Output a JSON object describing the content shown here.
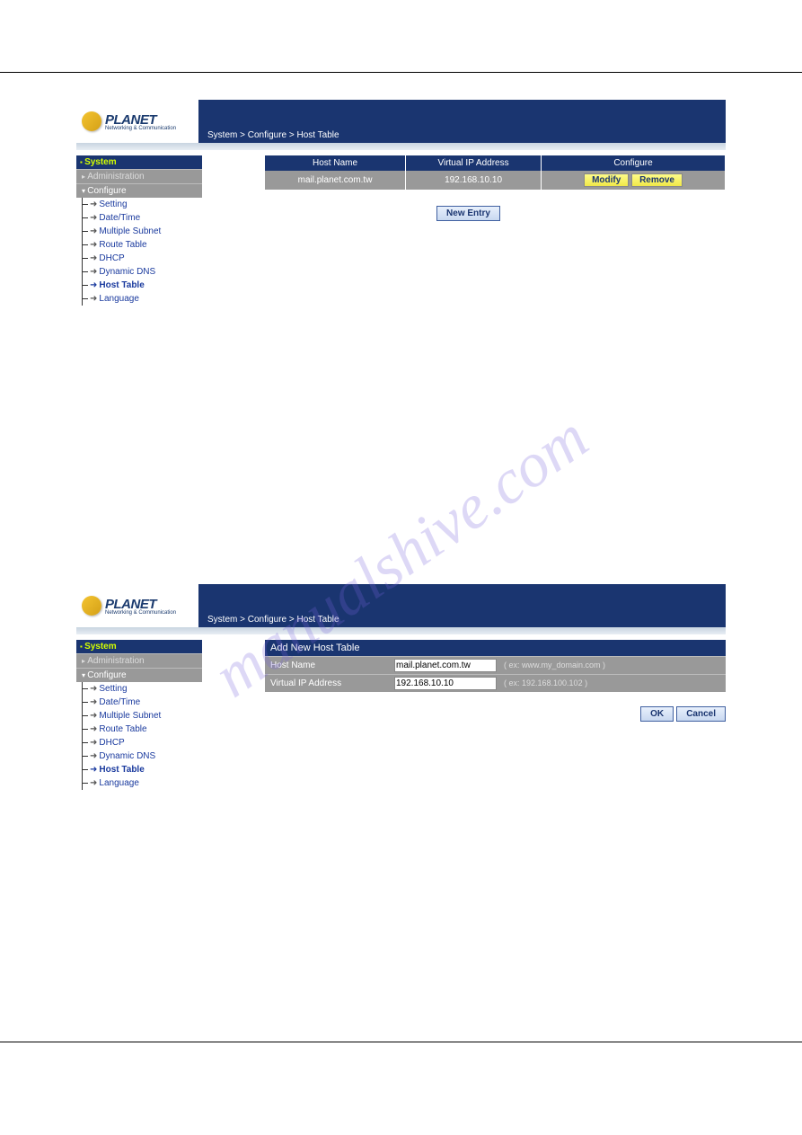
{
  "watermark": "manualshive.com",
  "brand": {
    "name": "PLANET",
    "tagline": "Networking & Communication"
  },
  "breadcrumb": {
    "sys": "System",
    "cfg": "Configure",
    "ht": "Host Table",
    "sep": " > "
  },
  "nav": {
    "system": "System",
    "admin": "Administration",
    "configure": "Configure",
    "items": [
      {
        "label": "Setting"
      },
      {
        "label": "Date/Time"
      },
      {
        "label": "Multiple Subnet"
      },
      {
        "label": "Route Table"
      },
      {
        "label": "DHCP"
      },
      {
        "label": "Dynamic DNS"
      },
      {
        "label": "Host Table"
      },
      {
        "label": "Language"
      }
    ]
  },
  "screen1": {
    "cols": {
      "hn": "Host Name",
      "vip": "Virtual IP Address",
      "cfg": "Configure"
    },
    "row": {
      "hn": "mail.planet.com.tw",
      "vip": "192.168.10.10"
    },
    "modify": "Modify",
    "remove": "Remove",
    "new": "New Entry"
  },
  "screen2": {
    "title": "Add New Host Table",
    "hn_label": "Host Name",
    "hn_val": "mail.planet.com.tw",
    "hn_ex": "( ex: www.my_domain.com )",
    "vip_label": "Virtual IP Address",
    "vip_val": "192.168.10.10",
    "vip_ex": "( ex: 192.168.100.102 )",
    "ok": "OK",
    "cancel": "Cancel"
  }
}
